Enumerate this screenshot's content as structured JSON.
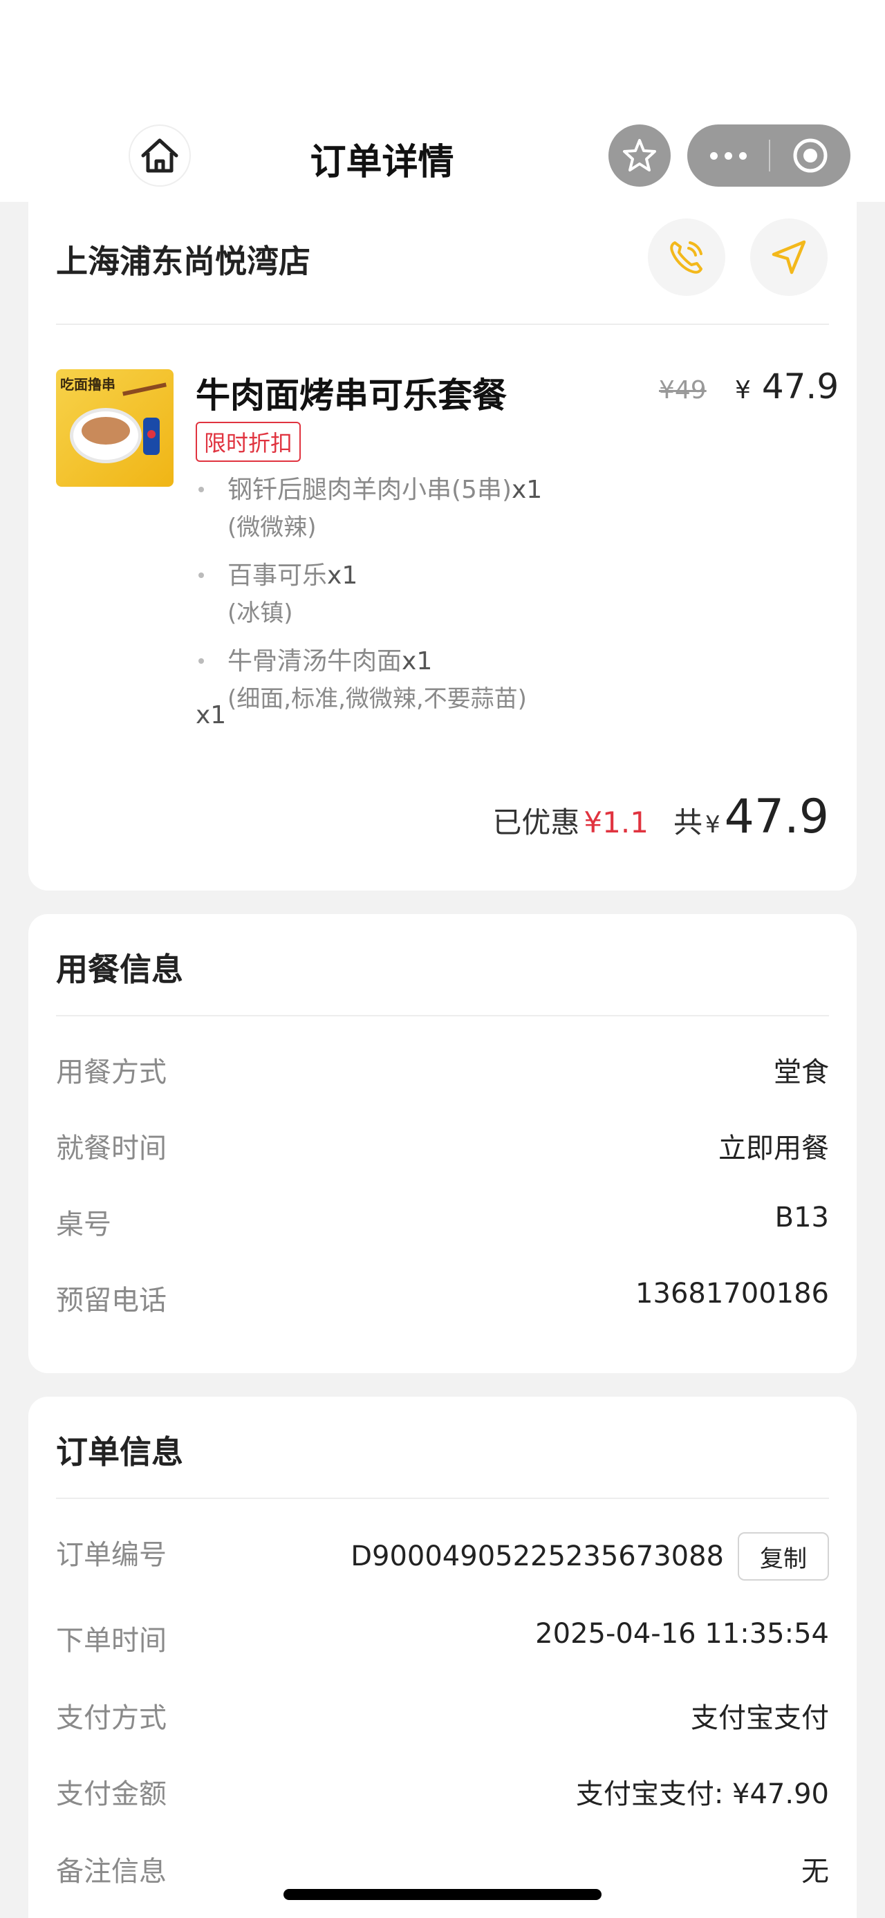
{
  "header": {
    "title": "订单详情"
  },
  "store": {
    "name": "上海浦东尚悦湾店"
  },
  "product": {
    "name": "牛肉面烤串可乐套餐",
    "badge": "限时折扣",
    "old_price": "¥49",
    "new_price_symbol": "¥",
    "new_price": "47.9",
    "quantity": "x1",
    "image_text": "吃面撸串",
    "items": [
      {
        "name": "钢钎后腿肉羊肉小串(5串)",
        "qty": "x1",
        "option": "(微微辣)"
      },
      {
        "name": "百事可乐",
        "qty": "x1",
        "option": "(冰镇)"
      },
      {
        "name": "牛骨清汤牛肉面",
        "qty": "x1",
        "option": "(细面,标准,微微辣,不要蒜苗)"
      }
    ]
  },
  "totals": {
    "discount_label": "已优惠",
    "discount_value": "¥1.1",
    "total_label": "共",
    "total_symbol": "¥",
    "total_value": "47.9"
  },
  "dining": {
    "title": "用餐信息",
    "rows": [
      {
        "label": "用餐方式",
        "value": "堂食"
      },
      {
        "label": "就餐时间",
        "value": "立即用餐"
      },
      {
        "label": "桌号",
        "value": "B13"
      },
      {
        "label": "预留电话",
        "value": "13681700186"
      }
    ]
  },
  "order": {
    "title": "订单信息",
    "order_no_label": "订单编号",
    "order_no": "D90004905225235673088",
    "copy_label": "复制",
    "rows": [
      {
        "label": "下单时间",
        "value": "2025-04-16 11:35:54"
      },
      {
        "label": "支付方式",
        "value": "支付宝支付"
      },
      {
        "label": "支付金额",
        "value": "支付宝支付: ¥47.90"
      },
      {
        "label": "备注信息",
        "value": "无"
      }
    ]
  },
  "colors": {
    "accent": "#f3b81b",
    "discount": "#e0333f"
  }
}
